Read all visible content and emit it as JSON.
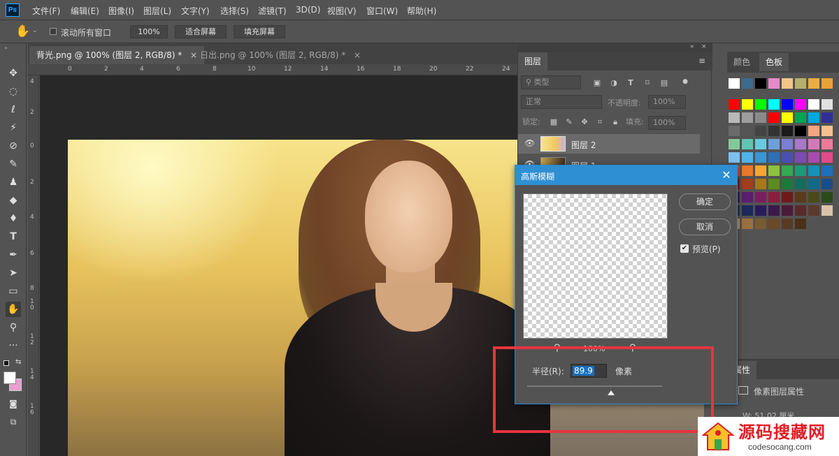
{
  "app": {
    "logo": "Ps"
  },
  "menu": [
    "文件(F)",
    "编辑(E)",
    "图像(I)",
    "图层(L)",
    "文字(Y)",
    "选择(S)",
    "滤镜(T)",
    "3D(D)",
    "视图(V)",
    "窗口(W)",
    "帮助(H)"
  ],
  "options": {
    "scroll_all_label": "滚动所有窗口",
    "zoom_value": "100%",
    "fit_screen_label": "适合屏幕",
    "fill_screen_label": "填充屏幕"
  },
  "tabs": [
    {
      "label": "背光.png @ 100% (图层 2, RGB/8) *",
      "active": true
    },
    {
      "label": "日出.png @ 100% (图层 2, RGB/8) *",
      "active": false
    }
  ],
  "ruler_top": [
    "0",
    "2",
    "4",
    "6",
    "8",
    "10",
    "12",
    "14",
    "16",
    "18",
    "20",
    "22",
    "24"
  ],
  "ruler_left": [
    "4",
    "2",
    "0",
    "2",
    "4",
    "6",
    "8",
    "1 0",
    "1 2",
    "1 4",
    "1 6"
  ],
  "layers_panel": {
    "tab": "图层",
    "filter_label": "类型",
    "blend_mode": "正常",
    "opacity_label": "不透明度:",
    "opacity_value": "100%",
    "lock_label": "锁定:",
    "fill_label": "填充:",
    "fill_value": "100%",
    "layers": [
      {
        "name": "图层 2",
        "selected": true
      },
      {
        "name": "图层 1",
        "selected": false
      }
    ]
  },
  "swatch_panel": {
    "tabs": [
      "颜色",
      "色板"
    ],
    "active_tab": "色板",
    "rows": [
      [
        "#ffffff",
        "#3d6b8e",
        "#000000",
        "#e58bc8",
        "#f4c58a",
        "#b5b06a",
        "#e9ad45",
        "#e7a23a"
      ],
      [
        "#ff0000",
        "#ffff00",
        "#00ff00",
        "#00ffff",
        "#0000ff",
        "#ff00ff",
        "#ffffff",
        "#e0e0e0"
      ],
      [
        "#b8b8b8",
        "#9e9e9e",
        "#8a8a8a",
        "#ff0000",
        "#ffff00",
        "#00a651",
        "#00a8e0",
        "#2e3192"
      ],
      [
        "#6a6a6a",
        "#555555",
        "#444444",
        "#333333",
        "#1a1a1a",
        "#000000",
        "#f4a582",
        "#f7c08f"
      ],
      [
        "#86c89a",
        "#60c4b3",
        "#69c9e0",
        "#6f9fd8",
        "#7a7fd1",
        "#a779c8",
        "#d27ab8",
        "#ee7a9a"
      ],
      [
        "#7ec0ee",
        "#4fb3e8",
        "#3a95d4",
        "#2f6fb6",
        "#4b4fb0",
        "#7c4bb0",
        "#a84bb0",
        "#e04b8a"
      ],
      [
        "#d84a3a",
        "#e8792a",
        "#f2a92a",
        "#8fc23f",
        "#34a853",
        "#1c9a7a",
        "#1592b8",
        "#1f6fb8"
      ],
      [
        "#8a1c1c",
        "#a33d1c",
        "#a6781a",
        "#5e8a1f",
        "#1b7a3a",
        "#116d5a",
        "#0f6a8a",
        "#1a4d8a"
      ],
      [
        "#3a1e6e",
        "#5a1e6e",
        "#7a1e5e",
        "#8a1e3e",
        "#6e1a1a",
        "#5a3a1a",
        "#4a4a1a",
        "#2a4a1a"
      ],
      [
        "#1a3a5a",
        "#1a2a5a",
        "#2a1a5a",
        "#3a1a4a",
        "#4a1a3a",
        "#5a2a2a",
        "#5a3a2a",
        "#d9c4a8"
      ],
      [
        "#b89060",
        "#9a7040",
        "#7a5a30",
        "#6a4a28",
        "#5a3a20",
        "#4a3018"
      ]
    ]
  },
  "props_panel": {
    "tab": "属性",
    "title": "像素图层属性",
    "w_value": "W: 51.02 厘米"
  },
  "dialog": {
    "title": "高斯模糊",
    "ok_label": "确定",
    "cancel_label": "取消",
    "preview_label": "预览(P)",
    "zoom_label": "100%",
    "radius_label": "半径(R):",
    "radius_value": "89.9",
    "radius_unit": "像素",
    "radius_slider_fraction": 0.62
  },
  "watermark": {
    "text": "源码搜藏网",
    "url": "codesocang.com"
  },
  "colors": {
    "accent": "#2e8fd3",
    "highlight": "#e8343f",
    "ps_blue": "#31a8ff"
  }
}
